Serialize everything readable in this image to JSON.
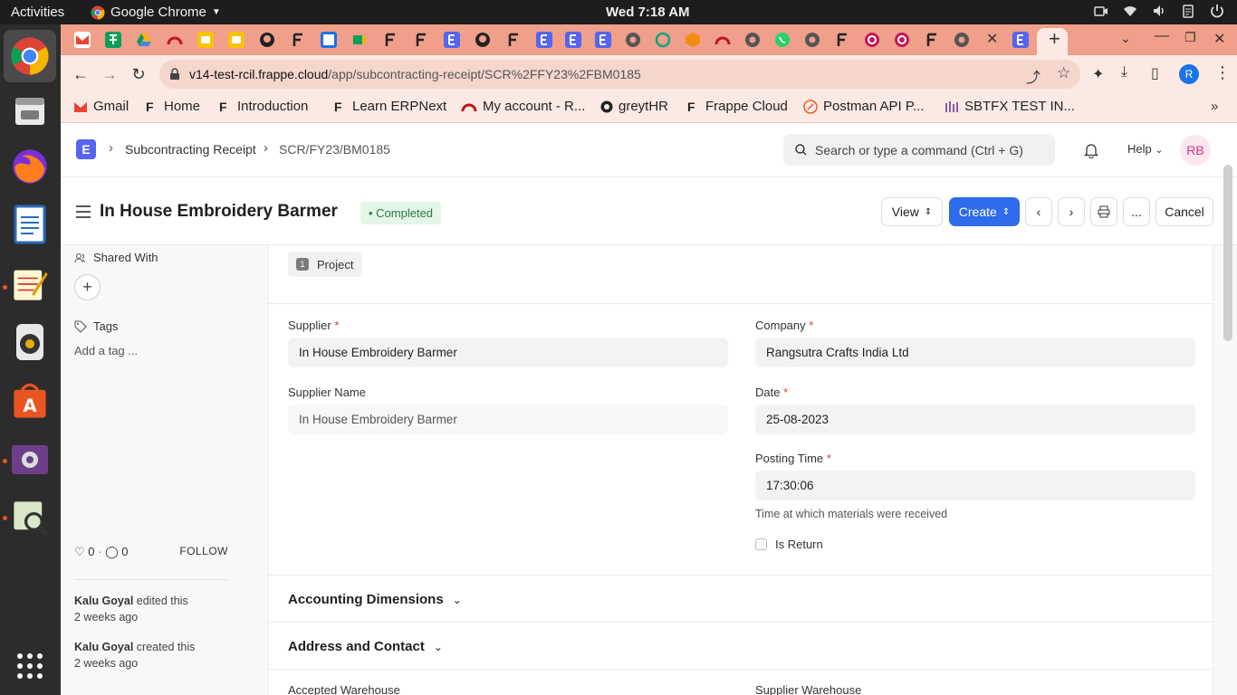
{
  "system": {
    "activities": "Activities",
    "app_name": "Google Chrome",
    "clock": "Wed  7:18 AM"
  },
  "browser": {
    "url_host": "v14-test-rcil.frappe.cloud",
    "url_path": "/app/subcontracting-receipt/SCR%2FFY23%2FBM0185",
    "profile_initial": "R",
    "bookmarks": [
      {
        "label": "Gmail",
        "icon": "gmail-icon"
      },
      {
        "label": "Home",
        "icon": "frappe-icon"
      },
      {
        "label": "Introduction",
        "icon": "frappe-icon"
      },
      {
        "label": "Learn ERPNext",
        "icon": "frappe-icon"
      },
      {
        "label": "My account - R...",
        "icon": "frappe-cloud-icon"
      },
      {
        "label": "greytHR",
        "icon": "greythr-icon"
      },
      {
        "label": "Frappe Cloud",
        "icon": "frappe-icon"
      },
      {
        "label": "Postman API P...",
        "icon": "postman-icon"
      },
      {
        "label": "SBTFX TEST IN...",
        "icon": "sbtfx-icon"
      }
    ]
  },
  "app": {
    "breadcrumb": [
      "Subcontracting Receipt",
      "SCR/FY23/BM0185"
    ],
    "search_placeholder": "Search or type a command (Ctrl + G)",
    "help_label": "Help",
    "user_initials": "RB"
  },
  "doc": {
    "title": "In House Embroidery Barmer",
    "status": "Completed",
    "status_color": "#2b7a3f",
    "actions": {
      "view": "View",
      "create": "Create",
      "cancel": "Cancel",
      "more": "..."
    }
  },
  "sidebar": {
    "shared_with": "Shared With",
    "tags_label": "Tags",
    "add_tag": "Add a tag ...",
    "likes": "0",
    "comments": "0",
    "follow": "FOLLOW",
    "activity": [
      {
        "user": "Kalu Goyal",
        "action": "edited this",
        "time": "2 weeks ago"
      },
      {
        "user": "Kalu Goyal",
        "action": "created this",
        "time": "2 weeks ago"
      }
    ]
  },
  "form": {
    "project_pill": {
      "num": "1",
      "label": "Project"
    },
    "supplier": {
      "label": "Supplier",
      "value": "In House Embroidery Barmer"
    },
    "supplier_name": {
      "label": "Supplier Name",
      "value": "In House Embroidery Barmer"
    },
    "company": {
      "label": "Company",
      "value": "Rangsutra Crafts India Ltd"
    },
    "date": {
      "label": "Date",
      "value": "25-08-2023"
    },
    "posting_time": {
      "label": "Posting Time",
      "value": "17:30:06",
      "help": "Time at which materials were received"
    },
    "is_return": {
      "label": "Is Return",
      "checked": false
    },
    "sections": [
      "Accounting Dimensions",
      "Address and Contact"
    ],
    "accepted_warehouse": "Accepted Warehouse",
    "supplier_warehouse": "Supplier Warehouse"
  },
  "colors": {
    "accent": "#2f6bea",
    "brand": "#5565f0",
    "tab_strip": "#ef9f8a"
  }
}
